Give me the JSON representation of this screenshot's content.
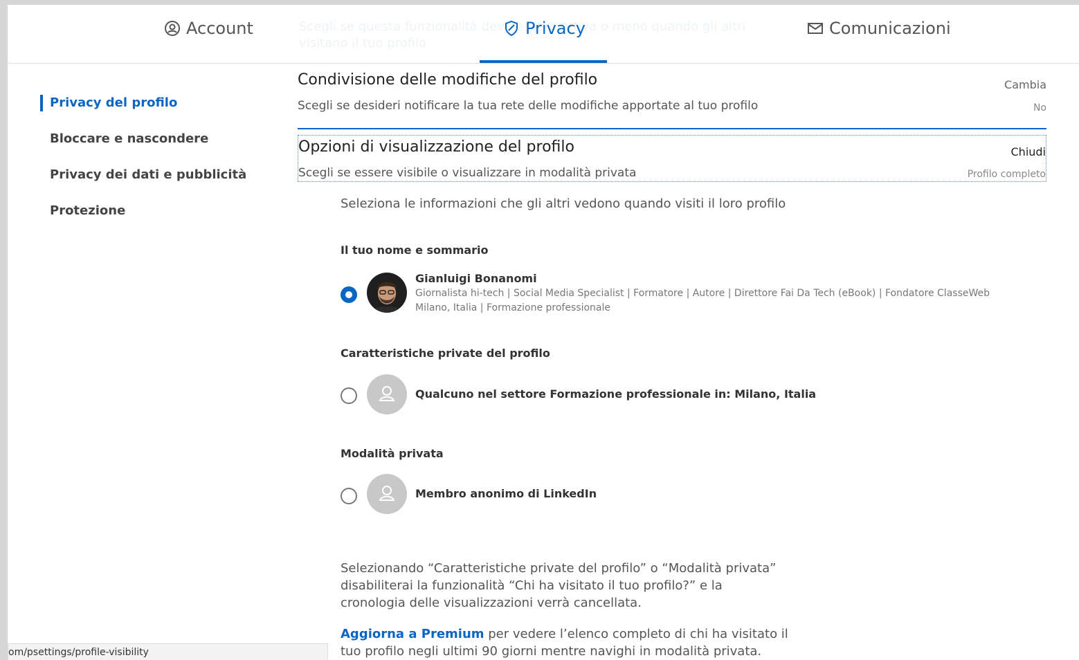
{
  "nav": {
    "background_ghost_text": "Scegli se questa funzionalità deve essere attiva o meno quando gli altri visitano il tuo profilo",
    "tabs": [
      {
        "label": "Account",
        "icon": "account-icon"
      },
      {
        "label": "Privacy",
        "icon": "shield-icon",
        "active": true
      },
      {
        "label": "Comunicazioni",
        "icon": "envelope-icon"
      }
    ]
  },
  "sidebar": {
    "items": [
      {
        "label": "Privacy del profilo",
        "active": true
      },
      {
        "label": "Bloccare e nascondere"
      },
      {
        "label": "Privacy dei dati e pubblicità"
      },
      {
        "label": "Protezione"
      }
    ]
  },
  "settings": [
    {
      "title": "Condivisione delle modifiche del profilo",
      "description": "Scegli se desideri notificare la tua rete delle modifiche apportate al tuo profilo",
      "action": "Cambia",
      "value": "No"
    },
    {
      "title": "Opzioni di visualizzazione del profilo",
      "description": "Scegli se essere visibile o visualizzare in modalità privata",
      "action": "Chiudi",
      "value": "Profilo completo"
    }
  ],
  "visibility": {
    "intro": "Seleziona le informazioni che gli altri vedono quando visiti il loro profilo",
    "options": [
      {
        "group": "Il tuo nome e sommario",
        "name": "Gianluigi Bonanomi",
        "headline": "Giornalista hi-tech | Social Media Specialist | Formatore | Autore | Direttore Fai Da Tech (eBook) | Fondatore ClasseWeb",
        "location": "Milano, Italia | Formazione professionale",
        "selected": true
      },
      {
        "group": "Caratteristiche private del profilo",
        "name": "Qualcuno nel settore Formazione professionale in: Milano, Italia",
        "selected": false
      },
      {
        "group": "Modalità privata",
        "name": "Membro anonimo di LinkedIn",
        "selected": false
      }
    ],
    "note": "Selezionando “Caratteristiche private del profilo” o “Modalità privata” disabiliterai la funzionalità “Chi ha visitato il tuo profilo?” e la cronologia delle visualizzazioni verrà cancellata.",
    "premium_link": "Aggiorna a Premium",
    "premium_text": " per vedere l’elenco completo di chi ha visitato il tuo profilo negli ultimi 90 giorni mentre navighi in modalità privata."
  },
  "statusbar": {
    "url": "om/psettings/profile-visibility"
  },
  "colors": {
    "accent": "#0a66c2",
    "avatar_placeholder": "#c8c8c8"
  }
}
